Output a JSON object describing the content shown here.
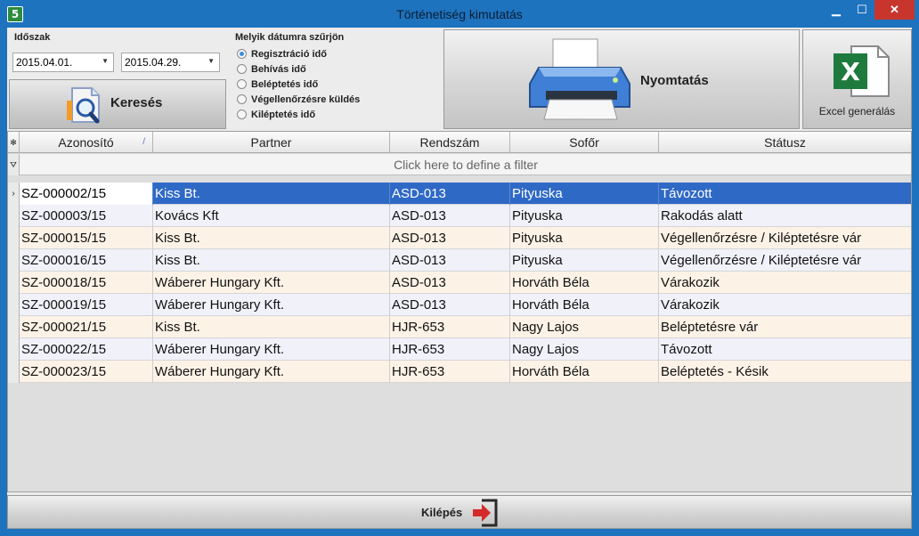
{
  "window": {
    "title": "Történetiség kimutatás",
    "min_glyph": "▁",
    "max_glyph": "☐",
    "close_glyph": "✕",
    "app_icon_glyph": "5"
  },
  "period": {
    "label": "Időszak",
    "from": "2015.04.01.",
    "to": "2015.04.29.",
    "dropdown_glyph": "▼"
  },
  "search": {
    "label": "Keresés"
  },
  "date_filter": {
    "label": "Melyik dátumra szűrjön",
    "options": [
      {
        "label": "Regisztráció idő",
        "selected": true
      },
      {
        "label": "Behívás idő",
        "selected": false
      },
      {
        "label": "Beléptetés idő",
        "selected": false
      },
      {
        "label": "Végellenőrzésre küldés",
        "selected": false
      },
      {
        "label": "Kiléptetés idő",
        "selected": false
      }
    ]
  },
  "print": {
    "label": "Nyomtatás"
  },
  "excel": {
    "label": "Excel generálás",
    "icon_letter": "X"
  },
  "grid": {
    "columns": [
      "Azonosító",
      "Partner",
      "Rendszám",
      "Sofőr",
      "Státusz"
    ],
    "sort_glyph": "/",
    "filter_text": "Click here to define a filter",
    "header_corner_glyph": "✻",
    "filter_glyph": "⛛",
    "current_row_glyph": "›",
    "rows": [
      [
        "SZ-000002/15",
        "Kiss Bt.",
        "ASD-013",
        "Pityuska",
        "Távozott"
      ],
      [
        "SZ-000003/15",
        "Kovács Kft",
        "ASD-013",
        "Pityuska",
        "Rakodás alatt"
      ],
      [
        "SZ-000015/15",
        "Kiss Bt.",
        "ASD-013",
        "Pityuska",
        "Végellenőrzésre / Kiléptetésre vár"
      ],
      [
        "SZ-000016/15",
        "Kiss Bt.",
        "ASD-013",
        "Pityuska",
        "Végellenőrzésre / Kiléptetésre vár"
      ],
      [
        "SZ-000018/15",
        "Wáberer Hungary Kft.",
        "ASD-013",
        "Horváth Béla",
        "Várakozik"
      ],
      [
        "SZ-000019/15",
        "Wáberer Hungary Kft.",
        "ASD-013",
        "Horváth Béla",
        "Várakozik"
      ],
      [
        "SZ-000021/15",
        "Kiss Bt.",
        "HJR-653",
        "Nagy Lajos",
        "Beléptetésre vár"
      ],
      [
        "SZ-000022/15",
        "Wáberer Hungary Kft.",
        "HJR-653",
        "Nagy Lajos",
        "Távozott"
      ],
      [
        "SZ-000023/15",
        "Wáberer Hungary Kft.",
        "HJR-653",
        "Horváth Béla",
        "Beléptetés - Késik"
      ]
    ],
    "selected_row": 0
  },
  "exit": {
    "label": "Kilépés"
  },
  "colors": {
    "window_frame": "#1e73be",
    "selected_row": "#2f69c6",
    "row_odd": "#fdf2e6",
    "row_even": "#f1f1fa",
    "excel_green": "#1f7a3e",
    "exit_arrow": "#d42a2a"
  }
}
